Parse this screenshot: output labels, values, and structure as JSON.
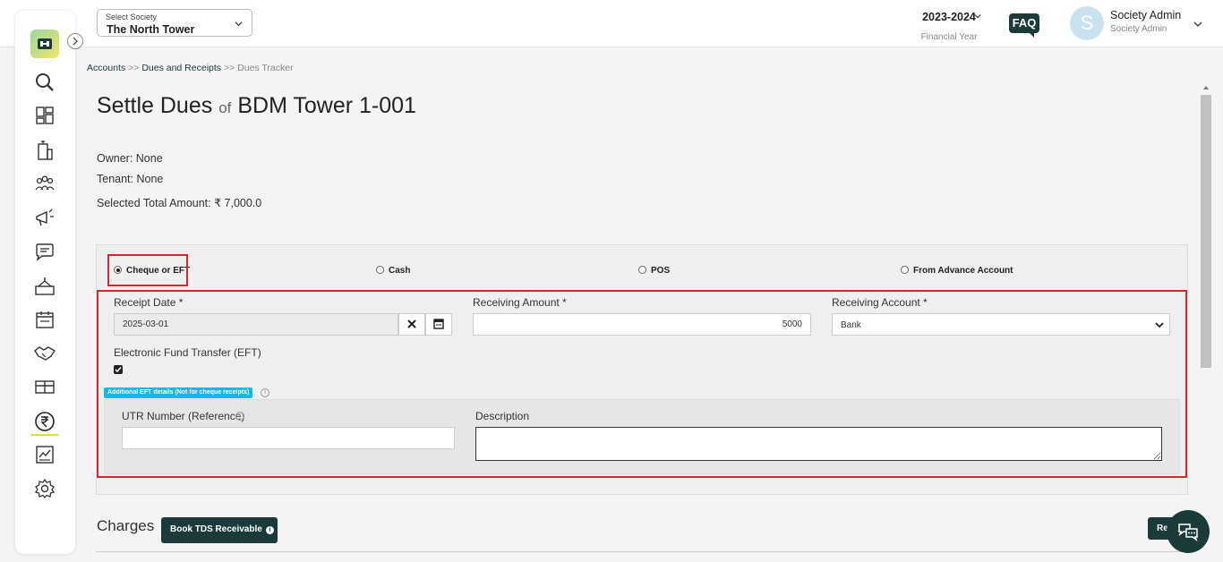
{
  "header": {
    "society_select": {
      "label": "Select Society",
      "value": "The North Tower"
    },
    "financial_year": {
      "value": "2023-2024",
      "label": "Financial Year"
    },
    "faq_label": "FAQ",
    "user": {
      "initial": "S",
      "name": "Society Admin",
      "role": "Society Admin"
    }
  },
  "breadcrumb": {
    "accounts": "Accounts",
    "sep": ">>",
    "dues_receipts": "Dues and Receipts",
    "current": "Dues Tracker"
  },
  "page": {
    "title_prefix": "Settle Dues",
    "title_of": "of",
    "title_unit": "BDM Tower 1-001",
    "owner": "Owner: None",
    "tenant": "Tenant: None",
    "selected_total": "Selected Total Amount: ₹ 7,000.0"
  },
  "payment_modes": {
    "selected": "Cheque or EFT",
    "options": [
      "Cheque or EFT",
      "Cash",
      "POS",
      "From Advance Account"
    ]
  },
  "form": {
    "receipt_date": {
      "label": "Receipt Date *",
      "value": "2025-03-01"
    },
    "receiving_amount": {
      "label": "Receiving Amount *",
      "value": "5000"
    },
    "receiving_account": {
      "label": "Receiving Account *",
      "value": "Bank"
    },
    "eft": {
      "label": "Electronic Fund Transfer (EFT)",
      "checked": true
    },
    "eft_badge": "Additional EFT details (Not for cheque receipts)",
    "utr": {
      "label": "UTR Number (Reference)",
      "value": ""
    },
    "description": {
      "label": "Description",
      "value": ""
    }
  },
  "charges": {
    "title": "Charges",
    "tds_button": "Book TDS Receivable",
    "right_button": "Re"
  },
  "icons": {
    "accent": "#1b3a3a",
    "highlight": "#d9262c",
    "badge": "#16b8e6"
  }
}
